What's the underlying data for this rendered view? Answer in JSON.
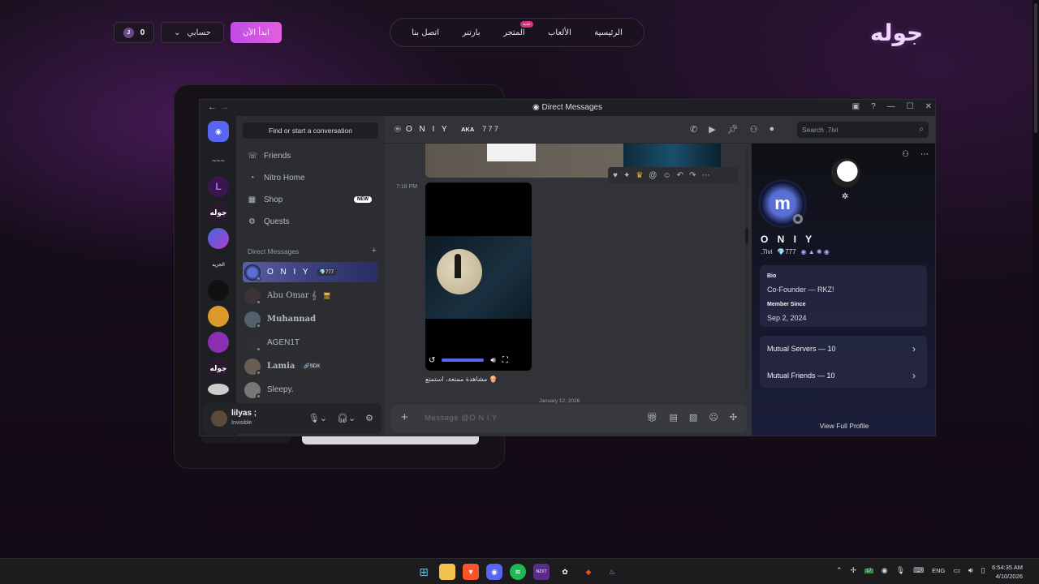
{
  "site": {
    "logo": "جوله",
    "nav": [
      "الرئيسية",
      "الألعاب",
      "المتجر",
      "بارتنر",
      "اتصل بنا"
    ],
    "store_badge": "جديد",
    "start_button": "ابدأ الآن",
    "account_button": "حسابي",
    "coins": "0",
    "coin_symbol": "J"
  },
  "window": {
    "title": "Direct Messages",
    "back": "←",
    "forward": "→"
  },
  "servers": [
    "~~~",
    "L",
    "جوله",
    "",
    "الجزيه",
    "",
    "",
    "",
    "جوله",
    ""
  ],
  "dm_column": {
    "find_placeholder": "Find or start a conversation",
    "nav": [
      {
        "label": "Friends",
        "icon": "friends-icon"
      },
      {
        "label": "Nitro Home",
        "icon": "nitro-icon"
      },
      {
        "label": "Shop",
        "icon": "shop-icon",
        "badge": "NEW"
      },
      {
        "label": "Quests",
        "icon": "quests-icon"
      }
    ],
    "section_title": "Direct Messages",
    "section_add": "+",
    "dms": [
      {
        "name": "O N I Y",
        "tag": "💎777",
        "active": true
      },
      {
        "name": "Abu Omar 𝄞",
        "tag": "🖥"
      },
      {
        "name": "Muhannad",
        "tag": ""
      },
      {
        "name": "AGEN1T",
        "tag": ""
      },
      {
        "name": "Lamia",
        "tag": "🔗SDX"
      },
      {
        "name": "Sleepy.",
        "tag": ""
      }
    ]
  },
  "user_panel": {
    "name": "lilyas ;",
    "status": "Invisible"
  },
  "chat": {
    "recipient": "O N I Y",
    "aka_label": "AKA",
    "aka_value": "777",
    "search_placeholder": "Search .7ivi",
    "message_time": "7:18 PM",
    "caption": "مشاهدة ممتعة، استمتع 🍿",
    "date_divider": "January 12, 2026",
    "composer_placeholder": "Message @O N I Y"
  },
  "profile": {
    "display_name": "O N I Y",
    "username": ".7ivi",
    "tag": "💎777",
    "bio_label": "Bio",
    "bio": "Co-Founder — RKZ!",
    "member_since_label": "Member Since",
    "member_since": "Sep 2, 2024",
    "mutual_servers": "Mutual Servers — 10",
    "mutual_friends": "Mutual Friends — 10",
    "view_full": "View Full Profile"
  },
  "taskbar": {
    "lang": "ENG",
    "time": "6:54:35 AM",
    "date": "4/10/2026",
    "badge_count": "17"
  },
  "colors": {
    "accent": "#5865f2",
    "site_button": "#d256e4",
    "background": "#140d1a"
  }
}
